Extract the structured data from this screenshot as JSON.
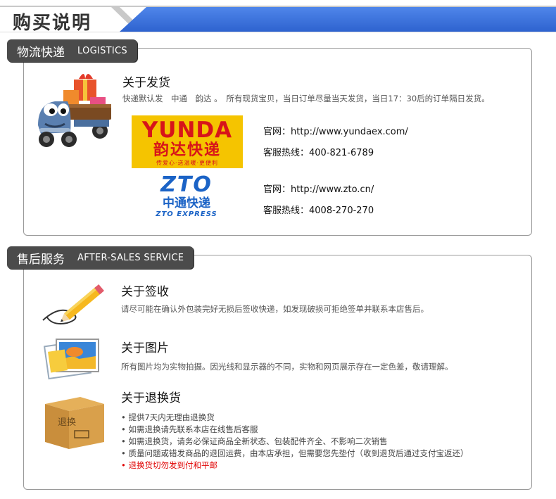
{
  "banner": {
    "title": "购买说明"
  },
  "logistics": {
    "tab_cn": "物流快递",
    "tab_en": "LOGISTICS",
    "heading": "关于发货",
    "desc": "快递默认发　中通　韵达 。　所有现货宝贝，当日订单尽量当天发货，当日17：30后的订单隔日发货。",
    "yunda": {
      "logo_en": "YUNDA",
      "logo_cn": "韵达快递",
      "logo_sub": "传爱心·送温暖·更便利",
      "website": "官网：http://www.yundaex.com/",
      "hotline": "客服热线：400-821-6789"
    },
    "zto": {
      "logo_mark": "ZTO",
      "logo_cn": "中通快递",
      "logo_en": "ZTO EXPRESS",
      "website": "官网：http://www.zto.cn/",
      "hotline": "客服热线：4008-270-270"
    }
  },
  "aftersales": {
    "tab_cn": "售后服务",
    "tab_en": "AFTER-SALES SERVICE",
    "sign": {
      "heading": "关于签收",
      "desc": "请尽可能在确认外包装完好无损后签收快递，如发现破损可拒绝签单并联系本店售后。"
    },
    "pictures": {
      "heading": "关于图片",
      "desc": "所有图片均为实物拍摄。因光线和显示器的不同，实物和网页展示存在一定色差，敬请理解。"
    },
    "returns": {
      "heading": "关于退换货",
      "box_label": "退换",
      "items": [
        "提供7天内无理由退换货",
        "如需退换请先联系本店在线售后客服",
        "如需退换货，请务必保证商品全新状态、包装配件齐全、不影响二次销售",
        "质量问题或错发商品的退回运费，由本店承担，但需要您先垫付（收到退货后通过支付宝返还）"
      ],
      "warning": "退换货切勿发到付和平邮"
    }
  },
  "colors": {
    "banner_blue": "#3a6fdc",
    "tab_bg": "#4b4b4b",
    "warning_red": "#e00000",
    "yunda_yellow": "#f5c400",
    "zto_blue": "#1b63c6"
  }
}
